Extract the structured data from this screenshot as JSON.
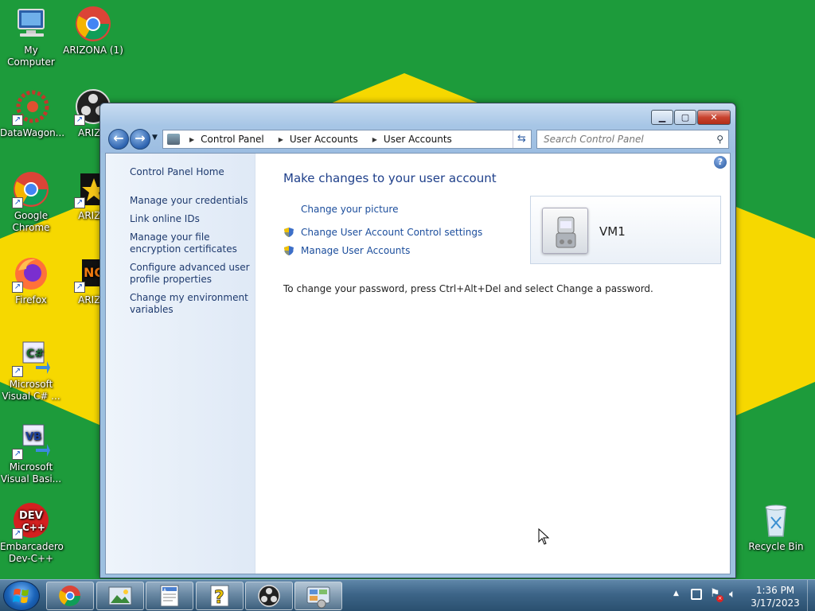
{
  "desktop": {
    "icons_left": [
      {
        "label": "My Computer"
      },
      {
        "label": "DataWagon..."
      },
      {
        "label": "Google Chrome"
      },
      {
        "label": "Firefox"
      },
      {
        "label": "Microsoft Visual C# ..."
      },
      {
        "label": "Microsoft Visual Basi..."
      },
      {
        "label": "Embarcadero Dev-C++"
      }
    ],
    "icons_second": [
      {
        "label": "ARIZONA (1)"
      },
      {
        "label": "ARIZO"
      },
      {
        "label": "ARIZO"
      },
      {
        "label": "ARIZO"
      }
    ],
    "recycle_bin": "Recycle Bin"
  },
  "window": {
    "address": {
      "crumbs": [
        "Control Panel",
        "User Accounts",
        "User Accounts"
      ]
    },
    "search_placeholder": "Search Control Panel",
    "left_pane": {
      "home": "Control Panel Home",
      "links": [
        "Manage your credentials",
        "Link online IDs",
        "Manage your file encryption certificates",
        "Configure advanced user profile properties",
        "Change my environment variables"
      ]
    },
    "main": {
      "heading": "Make changes to your user account",
      "links": [
        "Change your picture",
        "Change User Account Control settings",
        "Manage User Accounts"
      ],
      "password_note": "To change your password, press Ctrl+Alt+Del and select Change a password."
    },
    "user": {
      "name": "VM1"
    }
  },
  "taskbar": {
    "time": "1:36 PM",
    "date": "3/17/2023"
  }
}
